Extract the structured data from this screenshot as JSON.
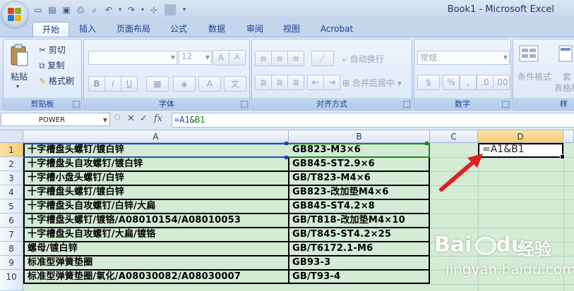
{
  "window": {
    "title": "Book1 - Microsoft Excel"
  },
  "quick_access": {
    "icons": [
      "new-icon",
      "open-icon",
      "save-icon",
      "print-icon",
      "print-preview-icon",
      "undo-icon",
      "redo-icon",
      "insert-icon",
      "customize-icon"
    ]
  },
  "tabs": [
    {
      "label": "开始",
      "active": true
    },
    {
      "label": "插入"
    },
    {
      "label": "页面布局"
    },
    {
      "label": "公式"
    },
    {
      "label": "数据"
    },
    {
      "label": "审阅"
    },
    {
      "label": "视图"
    },
    {
      "label": "Acrobat"
    }
  ],
  "ribbon": {
    "clipboard": {
      "label": "剪贴板",
      "paste": "粘贴",
      "cut": "剪切",
      "copy": "复制",
      "format_painter": "格式刷"
    },
    "font": {
      "label": "字体",
      "font_name": "",
      "font_size": "12",
      "bold": "B",
      "italic": "I",
      "underline": "U"
    },
    "alignment": {
      "label": "对齐方式",
      "wrap_text": "自动换行",
      "merge_center": "合并后居中"
    },
    "number": {
      "label": "数字",
      "format": "常规"
    },
    "styles": {
      "conditional": "条件格式",
      "table_format_1": "套",
      "table_format_2": "表格格",
      "label_partial": "样"
    }
  },
  "formula_bar": {
    "name_box": "POWER",
    "formula_part1": "=A1",
    "formula_amp": "&",
    "formula_part2": "B1"
  },
  "sheet": {
    "columns": [
      "A",
      "B",
      "C",
      "D"
    ],
    "rows": [
      "1",
      "2",
      "3",
      "4",
      "5",
      "6",
      "7",
      "8",
      "9",
      "10"
    ],
    "col_a": [
      "十字槽盘头螺钉/镀白锌",
      "十字槽盘头自攻螺钉/镀白锌",
      "十字槽小盘头螺钉/白锌",
      "十字槽盘头螺钉/镀白锌",
      "十字槽盘头自攻螺钉/白锌/大扁",
      "十字槽盘头螺钉/镀铬/A08010154/A08010053",
      "十字槽盘头自攻螺钉/大扁/镀铬",
      "螺母/镀白锌",
      "标准型弹簧垫圈",
      "标准型弹簧垫圈/氧化/A08030082/A08030007"
    ],
    "col_b": [
      "GB823-M3×6",
      "GB845-ST2.9×6",
      "GB/T823-M4×6",
      "GB823-改加垫M4×6",
      "GB845-ST4.2×8",
      "GB/T818-改加垫M4×10",
      "GB/T845-ST4.2×25",
      "GB/T6172.1-M6",
      "GB93-3",
      "GB/T93-4"
    ],
    "d1": "=A1&B1"
  },
  "watermark": {
    "brand": "Bai",
    "brand_end": "du",
    "jingyan": "经验",
    "url": "jingyan.baidu.com"
  }
}
